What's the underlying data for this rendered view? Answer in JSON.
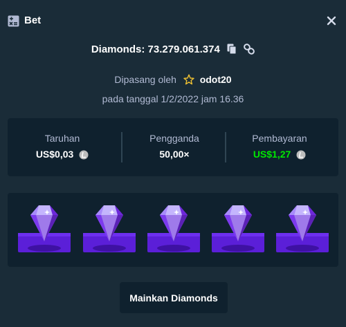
{
  "header": {
    "title": "Bet"
  },
  "game": {
    "label": "Diamonds: 73.279.061.374"
  },
  "placed": {
    "prefix": "Dipasang oleh",
    "username": "odot20"
  },
  "date_text": "pada tanggal 1/2/2022 jam 16.36",
  "stats": {
    "bet_label": "Taruhan",
    "bet_value": "US$0,03",
    "multiplier_label": "Pengganda",
    "multiplier_value": "50,00×",
    "payout_label": "Pembayaran",
    "payout_value": "US$1,27"
  },
  "gems": [
    "purple-diamond",
    "purple-diamond",
    "purple-diamond",
    "purple-diamond",
    "purple-diamond"
  ],
  "colors": {
    "background": "#1a2c38",
    "panel": "#0f212e",
    "muted_text": "#b1bad3",
    "payout_green": "#00e701",
    "gem_purple": "#8b5cf6"
  },
  "play_button": {
    "label": "Mainkan Diamonds"
  }
}
